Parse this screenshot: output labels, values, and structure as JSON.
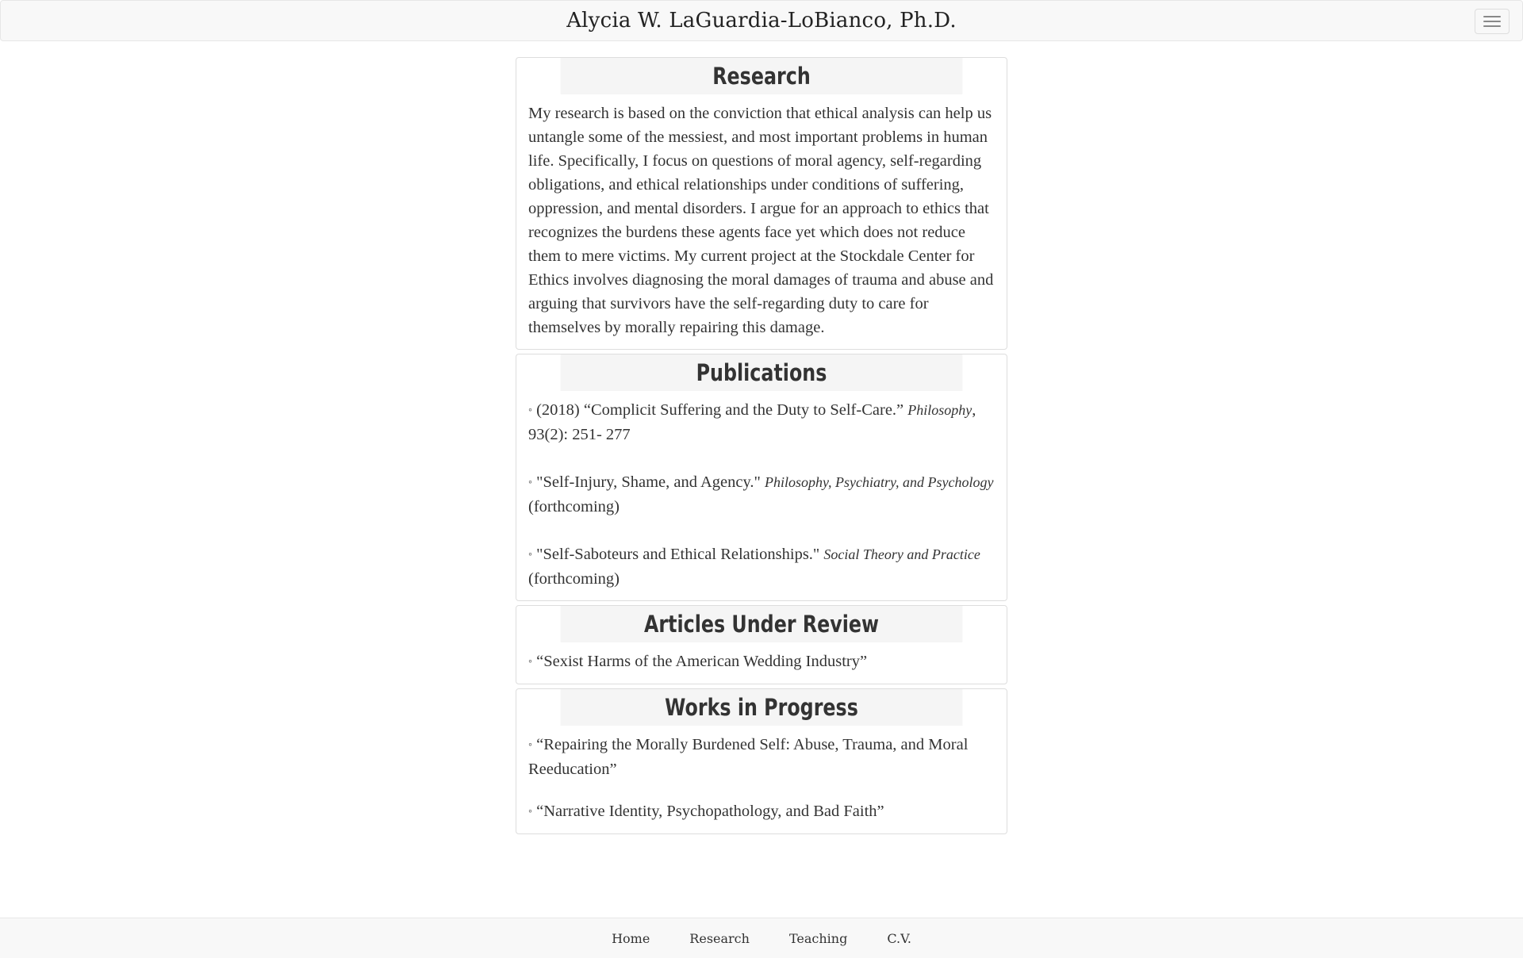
{
  "navbar": {
    "brand": "Alycia W. LaGuardia-LoBianco, Ph.D.",
    "toggle_icon": "hamburger-menu-icon"
  },
  "research": {
    "heading": "Research",
    "body": "My research is based on the conviction that ethical analysis can help us untangle some of the messiest, and most important problems in human life. Specifically, I focus on questions of moral agency, self-regarding obligations, and ethical relationships under conditions of suffering, oppression, and mental disorders. I argue for an approach to ethics that recognizes the burdens these agents face yet which does not reduce them to mere victims. My current project at the Stockdale Center for Ethics involves diagnosing the moral damages of trauma and abuse and arguing that survivors have the self-regarding duty to care for themselves by morally repairing this damage."
  },
  "publications": {
    "heading": "Publications",
    "bullet": "◦",
    "items": [
      {
        "title": "(2018) “Complicit Suffering and the Duty to Self-Care.”",
        "journal": "Philosophy",
        "after": ", 93(2): 251- 277"
      },
      {
        "title": "\"Self-Injury, Shame, and Agency.\"",
        "journal": "Philosophy, Psychiatry, and Psychology",
        "after": " (forthcoming)"
      },
      {
        "title": "\"Self-Saboteurs and Ethical Relationships.\"",
        "journal": "Social Theory and Practice",
        "after": " (forthcoming)"
      }
    ]
  },
  "under_review": {
    "heading": "Articles Under Review",
    "items": [
      "“Sexist Harms of the American Wedding Industry”"
    ]
  },
  "in_progress": {
    "heading": "Works in Progress",
    "items": [
      "“Repairing the Morally Burdened Self: Abuse, Trauma, and Moral Reeducation”",
      "“Narrative Identity, Psychopathology, and Bad Faith”"
    ]
  },
  "footer": {
    "links": [
      "Home",
      "Research",
      "Teaching",
      "C.V."
    ]
  }
}
